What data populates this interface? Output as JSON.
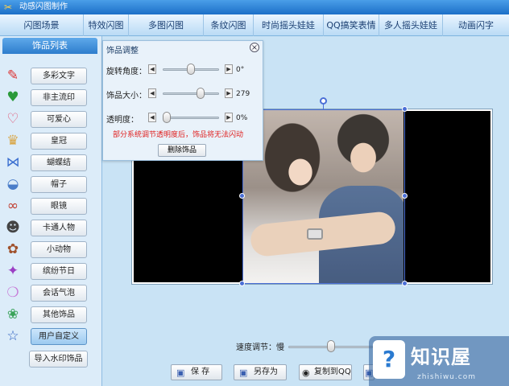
{
  "window": {
    "title": "动感闪图制作"
  },
  "tabs": [
    {
      "label": "闪图场景"
    },
    {
      "label": "特效闪图"
    },
    {
      "label": "多图闪图"
    },
    {
      "label": "条纹闪图"
    },
    {
      "label": "时尚摇头娃娃"
    },
    {
      "label": "QQ搞笑表情"
    },
    {
      "label": "多人摇头娃娃"
    },
    {
      "label": "动画闪字"
    }
  ],
  "sidebar": {
    "title": "饰品列表",
    "items": [
      {
        "label": "多彩文字",
        "icon": "colorful-text-icon"
      },
      {
        "label": "非主流印",
        "icon": "heart-stamp-icon"
      },
      {
        "label": "可爱心",
        "icon": "heart-outline-icon"
      },
      {
        "label": "皇冠",
        "icon": "crown-icon"
      },
      {
        "label": "蝴蝶结",
        "icon": "bow-icon"
      },
      {
        "label": "帽子",
        "icon": "hat-icon"
      },
      {
        "label": "眼镜",
        "icon": "glasses-icon"
      },
      {
        "label": "卡通人物",
        "icon": "cartoon-face-icon"
      },
      {
        "label": "小动物",
        "icon": "animal-icon"
      },
      {
        "label": "缤纷节日",
        "icon": "gift-icon"
      },
      {
        "label": "会话气泡",
        "icon": "speech-bubble-icon"
      },
      {
        "label": "其他饰品",
        "icon": "misc-icon"
      },
      {
        "label": "用户自定义",
        "icon": "star-icon"
      },
      {
        "label": "导入水印饰品",
        "icon": ""
      }
    ],
    "active_index": 12
  },
  "adjust_panel": {
    "title": "饰品调整",
    "rotation": {
      "label": "旋转角度：",
      "value": "0°",
      "level": 0.5
    },
    "size": {
      "label": "饰品大小：",
      "value": "279",
      "level": 0.7
    },
    "opacity": {
      "label": "透明度：",
      "value": "0%",
      "level": 0.0
    },
    "warning": "部分系统调节透明度后，饰品将无法闪动",
    "delete_label": "删除饰品"
  },
  "speed": {
    "label": "速度调节：慢",
    "level": 0.5
  },
  "actions": {
    "save": "保 存",
    "save_as": "另存为",
    "copy_qq": "复制到QQ"
  },
  "watermark": {
    "text": "知识屋",
    "sub": "zhishiwu.com"
  },
  "colors": {
    "accent": "#2d7dcd",
    "selection": "#4b6fd6",
    "warning": "#e0201f"
  }
}
